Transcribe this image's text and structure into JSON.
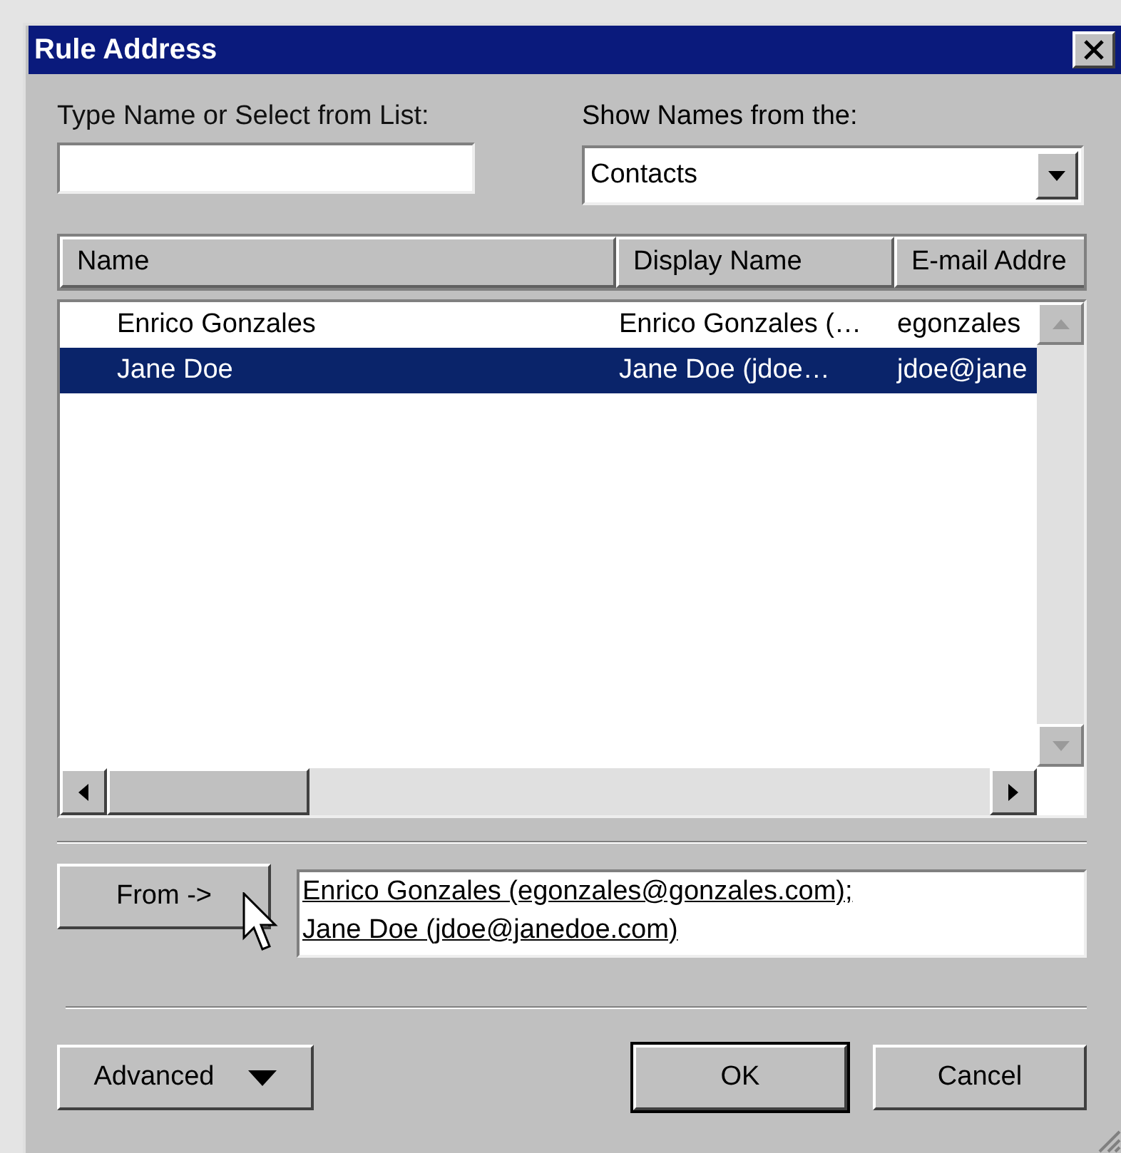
{
  "window": {
    "title": "Rule Address"
  },
  "type_name": {
    "label": "Type Name or Select from List:"
  },
  "show_names": {
    "label": "Show Names from the:",
    "value": "Contacts"
  },
  "table": {
    "columns": [
      "Name",
      "Display Name",
      "E-mail Addre"
    ],
    "rows": [
      {
        "cells": [
          "Enrico Gonzales",
          "Enrico Gonzales (…",
          "egonzales"
        ],
        "selected": false
      },
      {
        "cells": [
          "Jane Doe",
          "Jane Doe (jdoe…",
          "jdoe@jane"
        ],
        "selected": true
      }
    ]
  },
  "from_button": {
    "label": "From ->"
  },
  "recipients": [
    "Enrico Gonzales (egonzales@gonzales.com);",
    "Jane Doe (jdoe@janedoe.com)"
  ],
  "buttons": [
    {
      "label": "Advanced",
      "kind": "menu",
      "default": false
    },
    {
      "label": "OK",
      "kind": "plain",
      "default": true
    },
    {
      "label": "Cancel",
      "kind": "plain",
      "default": false
    }
  ]
}
